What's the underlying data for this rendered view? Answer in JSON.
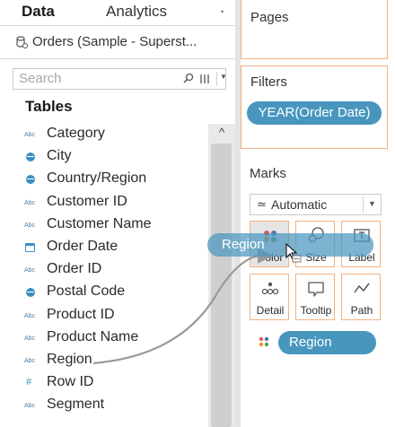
{
  "tabs": {
    "data": "Data",
    "analytics": "Analytics"
  },
  "datasource": {
    "name": "Orders (Sample - Superst..."
  },
  "search": {
    "placeholder": "Search"
  },
  "tables_heading": "Tables",
  "fields": [
    {
      "label": "Category",
      "type": "Abc"
    },
    {
      "label": "City",
      "type": "geo"
    },
    {
      "label": "Country/Region",
      "type": "geo"
    },
    {
      "label": "Customer ID",
      "type": "Abc"
    },
    {
      "label": "Customer Name",
      "type": "Abc"
    },
    {
      "label": "Order Date",
      "type": "date"
    },
    {
      "label": "Order ID",
      "type": "Abc"
    },
    {
      "label": "Postal Code",
      "type": "geo"
    },
    {
      "label": "Product ID",
      "type": "Abc"
    },
    {
      "label": "Product Name",
      "type": "Abc"
    },
    {
      "label": "Region",
      "type": "Abc"
    },
    {
      "label": "Row ID",
      "type": "#"
    },
    {
      "label": "Segment",
      "type": "Abc"
    }
  ],
  "pages_card": {
    "title": "Pages"
  },
  "filters_card": {
    "title": "Filters",
    "pill": "YEAR(Order Date)"
  },
  "marks_card": {
    "title": "Marks",
    "mark_type": "Automatic",
    "buttons": {
      "color": "Color",
      "size": "Size",
      "label": "Label",
      "detail": "Detail",
      "tooltip": "Tooltip",
      "path": "Path"
    },
    "region_pill": "Region"
  },
  "drag": {
    "pill": "Region"
  },
  "colors": {
    "pill_blue": "#4896be",
    "card_border": "#f3b17f",
    "icon_blue": "#3a8fbf"
  }
}
